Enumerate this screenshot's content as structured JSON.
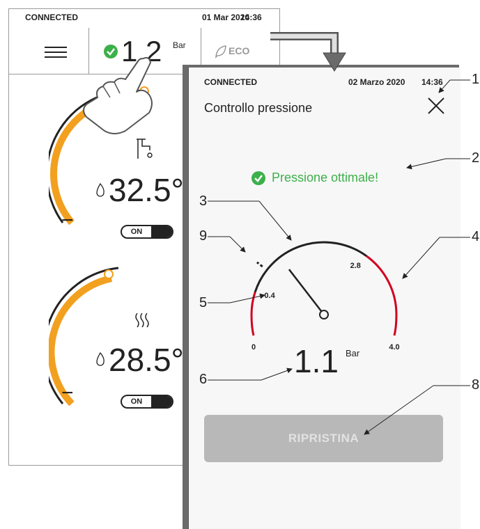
{
  "back_screen": {
    "status": "CONNECTED",
    "date": "01 Mar 2020",
    "time": "14:36",
    "pressure_value": "1.2",
    "pressure_unit": "Bar",
    "eco_label": "ECO",
    "dhw": {
      "temperature": "32.5°",
      "minus": "−",
      "toggle": "ON"
    },
    "heating": {
      "temperature": "28.5°",
      "minus": "−",
      "toggle": "ON"
    }
  },
  "front_screen": {
    "status": "CONNECTED",
    "date": "02 Marzo 2020",
    "time": "14:36",
    "title": "Controllo pressione",
    "status_message": "Pressione ottimale!",
    "pressure_value": "1.1",
    "pressure_unit": "Bar",
    "button_label": "RIPRISTINA",
    "gauge": {
      "min": 0,
      "max": 4.0,
      "value": 1.1,
      "low_threshold": 0.4,
      "high_threshold": 2.8,
      "label_min": "0",
      "label_low": "0.4",
      "label_high": "2.8",
      "label_max": "4.0"
    }
  },
  "callouts": [
    "1",
    "2",
    "3",
    "4",
    "5",
    "6",
    "8",
    "9"
  ],
  "colors": {
    "accent_orange": "#f2a01f",
    "warning_red": "#d1001f",
    "ok_green": "#3cb04a",
    "dark": "#222222"
  }
}
